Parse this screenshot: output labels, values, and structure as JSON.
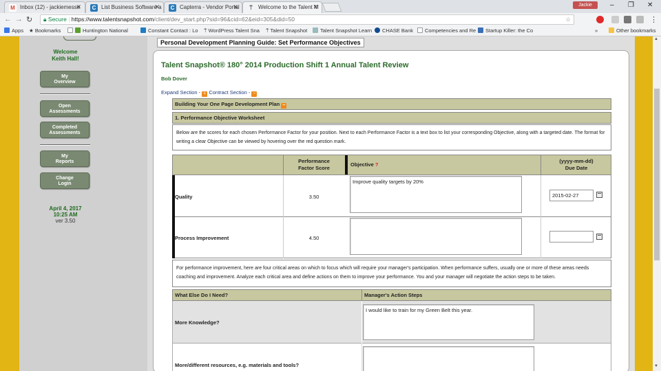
{
  "browser": {
    "tabs": [
      {
        "title": "Inbox (12) - jackiemesse",
        "icon_color": "#d44638",
        "icon_letter": "M"
      },
      {
        "title": "List Business Software a",
        "icon_color": "#2a7ab8",
        "icon_letter": "C"
      },
      {
        "title": "Capterra - Vendor Portal",
        "icon_color": "#2a7ab8",
        "icon_letter": "C"
      },
      {
        "title": "Welcome to the Talent M",
        "icon_color": "#f2f3f5",
        "icon_letter": "⍑"
      }
    ],
    "user_badge": "Jackie",
    "window_controls": {
      "minimize": "–",
      "restore": "❐",
      "close": "✕"
    },
    "secure_label": "Secure",
    "url_host": "https://www.talentsnapshot.com",
    "url_path": "/client/dev_start.php?sid=96&cid=62&eid=305&did=50",
    "bookmarks": [
      "Apps",
      "Bookmarks",
      "Huntington National",
      "Constant Contact : Lo",
      "WordPress Talent Sna",
      "Talent Snapshot",
      "Talent Snapshot Learn",
      "CHASE Bank",
      "Competencies and Re",
      "Startup Killer: the Co"
    ],
    "bookmarks_overflow": "»",
    "other_bookmarks": "Other bookmarks"
  },
  "sidebar": {
    "welcome": "Welcome",
    "user_name": "Keith Hall!",
    "buttons": [
      {
        "line1": "My",
        "line2": "Overview"
      },
      {
        "line1": "Open",
        "line2": "Assessments"
      },
      {
        "line1": "Completed",
        "line2": "Assessments"
      },
      {
        "line1": "My",
        "line2": "Reports"
      },
      {
        "line1": "Change",
        "line2": "Login"
      }
    ],
    "date": "April 4, 2017",
    "time": "10:25 AM",
    "version": "ver 3.50"
  },
  "main": {
    "panel_title": "Personal Development Planning Guide: Set Performance Objectives",
    "review_title": "Talent Snapshot® 180° 2014 Production Shift 1 Annual Talent Review",
    "employee": "Bob Dover",
    "expand_label": "Expand Section -",
    "contract_label": "Contract Section -",
    "plan_header": "Building Your One Page Development Plan",
    "worksheet_header": "1. Performance Objective Worksheet",
    "intro_text": "Below are the scores for each chosen Performance Factor for your position. Next to each Performance Factor is a text box to list your corresponding Objective, along with a targeted date. The format for writing a clear Objective can be viewed by hovering over the red question mark.",
    "columns": {
      "score_l1": "Performance",
      "score_l2": "Factor Score",
      "objective": "Objective",
      "objective_help": "?",
      "due_l1": "(yyyy-mm-dd)",
      "due_l2": "Due Date"
    },
    "rows": [
      {
        "factor": "Quality",
        "score": "3.50",
        "objective": "Improve quality targets by 20%",
        "due": "2015-02-27"
      },
      {
        "factor": "Process Improvement",
        "score": "4.50",
        "objective": "",
        "due": ""
      }
    ],
    "improvement_text": "For performance improvement, here are four critical areas on which to focus which will require your manager's participation. When performance suffers, usually one or more of these areas needs coaching and improvement. Analyze each critical area and define actions on them to improve your performance. You and your manager will negotiate the action steps to be taken.",
    "needs_header": {
      "left": "What Else Do I Need?",
      "right": "Manager's Action Steps"
    },
    "needs": [
      {
        "label": "More Knowledge?",
        "action": "I would like to train for my Green Belt this year."
      },
      {
        "label": "More/different resources, e.g. materials and tools?",
        "action": ""
      }
    ]
  }
}
